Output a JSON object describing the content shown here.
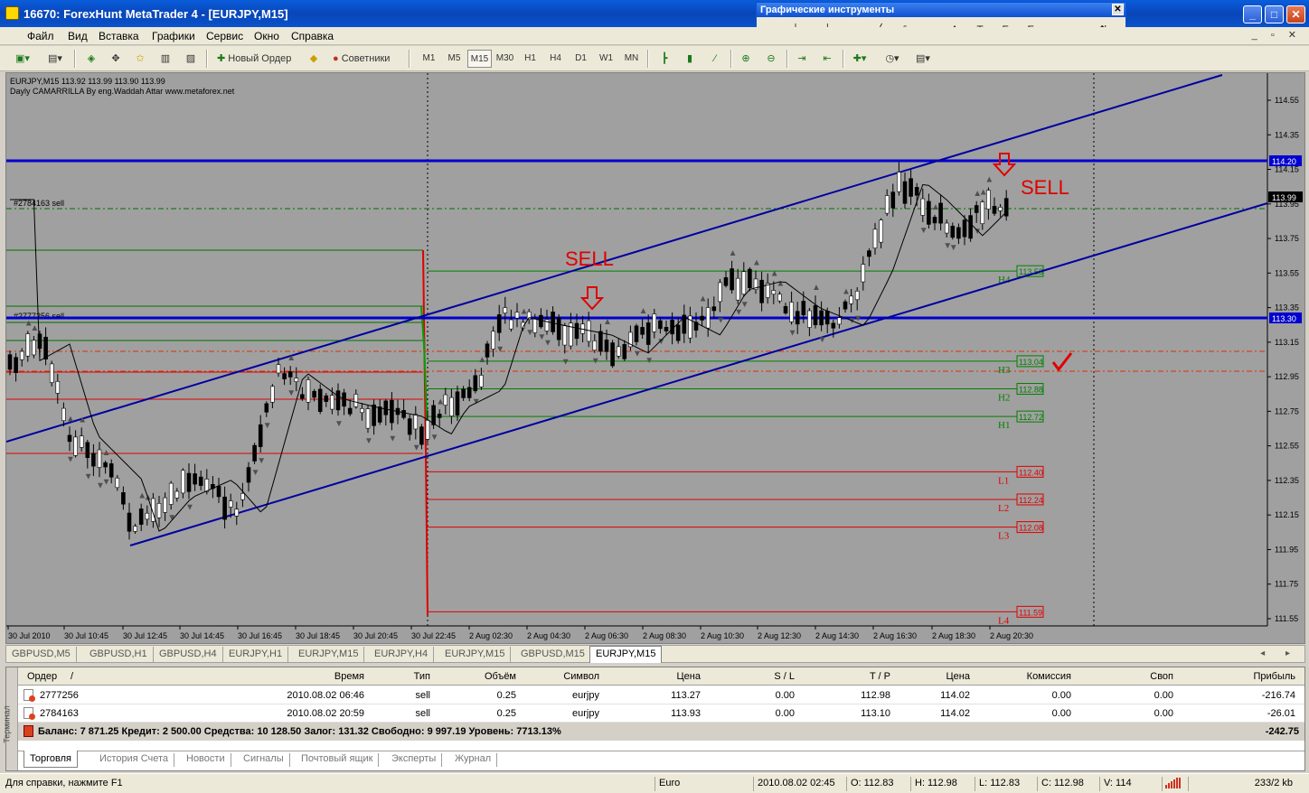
{
  "window": {
    "title": "16670: ForexHunt MetaTrader 4 - [EURJPY,M15]",
    "buttons": [
      "_",
      "□",
      "✕"
    ]
  },
  "graph_tools": {
    "title": "Графические инструменты",
    "close": "✕",
    "tools": [
      {
        "icon": "cursor-icon",
        "glyph": "↖"
      },
      {
        "icon": "crosshair-icon",
        "glyph": "┼"
      },
      {
        "icon": "vertical-line-icon",
        "glyph": "│"
      },
      {
        "icon": "horizontal-line-icon",
        "glyph": "─"
      },
      {
        "icon": "trendline-icon",
        "glyph": "╱"
      },
      {
        "icon": "equidistant-channel-icon",
        "glyph": "⫽"
      },
      {
        "icon": "standard-deviation-channel-icon",
        "glyph": "≡"
      },
      {
        "icon": "text-icon",
        "glyph": "A"
      },
      {
        "icon": "text-label-icon",
        "glyph": "T"
      },
      {
        "icon": "fibonacci-icon",
        "glyph": "F"
      },
      {
        "icon": "fibonacci-fan-icon",
        "glyph": "F"
      },
      {
        "icon": "ellipse-icon",
        "glyph": "⬭"
      },
      {
        "icon": "rectangle-icon",
        "glyph": "▭"
      },
      {
        "icon": "arrows-dropdown-icon",
        "glyph": "⇅▾"
      }
    ]
  },
  "menu": [
    "Файл",
    "Вид",
    "Вставка",
    "Графики",
    "Сервис",
    "Окно",
    "Справка"
  ],
  "toolbar": {
    "new_order": "Новый Ордер",
    "experts": "Советники",
    "timeframes": [
      "M1",
      "M5",
      "M15",
      "M30",
      "H1",
      "H4",
      "D1",
      "W1",
      "MN"
    ],
    "active_timeframe": "M15"
  },
  "chart": {
    "header": "EURJPY,M15  113.92 113.99 113.90 113.99",
    "indicator": "Dayly CAMARRILLA By eng.Waddah Attar www.metaforex.net",
    "order1_label": "#2784163 sell",
    "order2_label": "#2777256 sell",
    "sell1": "SELL",
    "sell2": "SELL",
    "price_axis": [
      "114.55",
      "114.35",
      "114.15",
      "113.95",
      "113.75",
      "113.55",
      "113.35",
      "113.15",
      "112.95",
      "112.75",
      "112.55",
      "112.35",
      "112.15",
      "111.95",
      "111.75",
      "111.55"
    ],
    "time_axis": [
      "30 Jul 2010",
      "30 Jul 10:45",
      "30 Jul 12:45",
      "30 Jul 14:45",
      "30 Jul 16:45",
      "30 Jul 18:45",
      "30 Jul 20:45",
      "30 Jul 22:45",
      "2 Aug 02:30",
      "2 Aug 04:30",
      "2 Aug 06:30",
      "2 Aug 08:30",
      "2 Aug 10:30",
      "2 Aug 12:30",
      "2 Aug 14:30",
      "2 Aug 16:30",
      "2 Aug 18:30",
      "2 Aug 20:30"
    ],
    "current_price": "113.99",
    "blue_level_top": "114.20",
    "blue_level_mid": "113.30",
    "camarilla": [
      {
        "name": "H4",
        "value": "113.53",
        "color": "#008000"
      },
      {
        "name": "H3",
        "value": "113.04",
        "color": "#008000"
      },
      {
        "name": "H2",
        "value": "112.88",
        "color": "#008000"
      },
      {
        "name": "H1",
        "value": "112.72",
        "color": "#008000"
      },
      {
        "name": "L1",
        "value": "112.40",
        "color": "#e00000"
      },
      {
        "name": "L2",
        "value": "112.24",
        "color": "#e00000"
      },
      {
        "name": "L3",
        "value": "112.08",
        "color": "#e00000"
      },
      {
        "name": "L4",
        "value": "111.59",
        "color": "#e00000"
      }
    ]
  },
  "chart_tabs": [
    "GBPUSD,M5",
    "GBPUSD,H1",
    "GBPUSD,H4",
    "EURJPY,H1",
    "EURJPY,M15",
    "EURJPY,H4",
    "EURJPY,M15",
    "GBPUSD,M15",
    "EURJPY,M15"
  ],
  "chart_tabs_active": 8,
  "terminal": {
    "side_label": "Терминал",
    "columns": [
      "Ордер",
      "/",
      "Время",
      "Тип",
      "Объём",
      "Символ",
      "Цена",
      "S / L",
      "T / P",
      "Цена",
      "Комиссия",
      "Своп",
      "Прибыль"
    ],
    "rows": [
      {
        "order": "2777256",
        "time": "2010.08.02 06:46",
        "type": "sell",
        "volume": "0.25",
        "symbol": "eurjpy",
        "price": "113.27",
        "sl": "0.00",
        "tp": "112.98",
        "cur": "114.02",
        "commission": "0.00",
        "swap": "0.00",
        "profit": "-216.74"
      },
      {
        "order": "2784163",
        "time": "2010.08.02 20:59",
        "type": "sell",
        "volume": "0.25",
        "symbol": "eurjpy",
        "price": "113.93",
        "sl": "0.00",
        "tp": "113.10",
        "cur": "114.02",
        "commission": "0.00",
        "swap": "0.00",
        "profit": "-26.01"
      }
    ],
    "balance": "Баланс: 7 871.25  Кредит: 2 500.00  Средства: 10 128.50  Залог: 131.32  Свободно: 9 997.19  Уровень: 7713.13%",
    "total": "-242.75",
    "tabs": [
      "Торговля",
      "История Счета",
      "Новости",
      "Сигналы",
      "Почтовый ящик",
      "Эксперты",
      "Журнал"
    ]
  },
  "status": {
    "help": "Для справки, нажмите F1",
    "profile": "Euro",
    "datetime": "2010.08.02 02:45",
    "open": "O: 112.83",
    "high": "H: 112.98",
    "low": "L: 112.83",
    "close": "C: 112.98",
    "volume": "V: 114",
    "traffic": "233/2 kb"
  }
}
